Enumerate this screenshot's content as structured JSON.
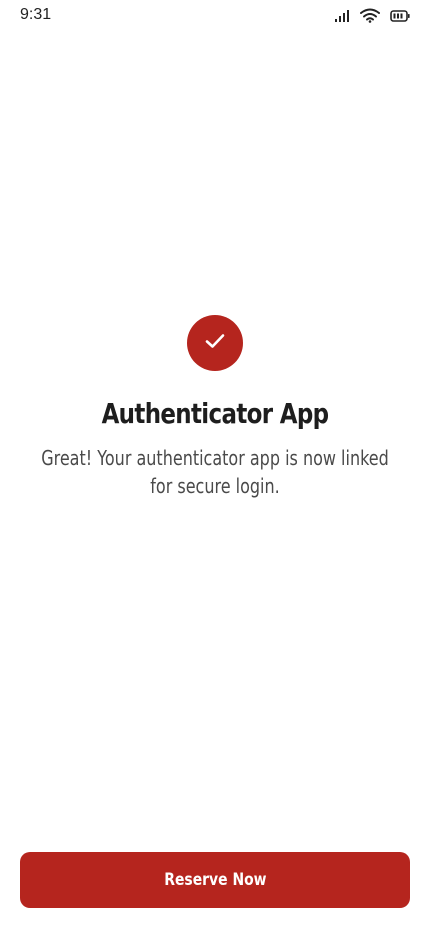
{
  "status_bar": {
    "time": "9:31",
    "icons": [
      "signal-icon",
      "wifi-icon",
      "battery-icon"
    ]
  },
  "main": {
    "icon": "checkmark-icon",
    "title": "Authenticator App",
    "message": "Great! Your authenticator app is now linked for secure login."
  },
  "actions": {
    "primary_label": "Reserve Now"
  },
  "colors": {
    "accent": "#b5251e",
    "background": "#ffffff",
    "text": "#1e1e1e"
  }
}
